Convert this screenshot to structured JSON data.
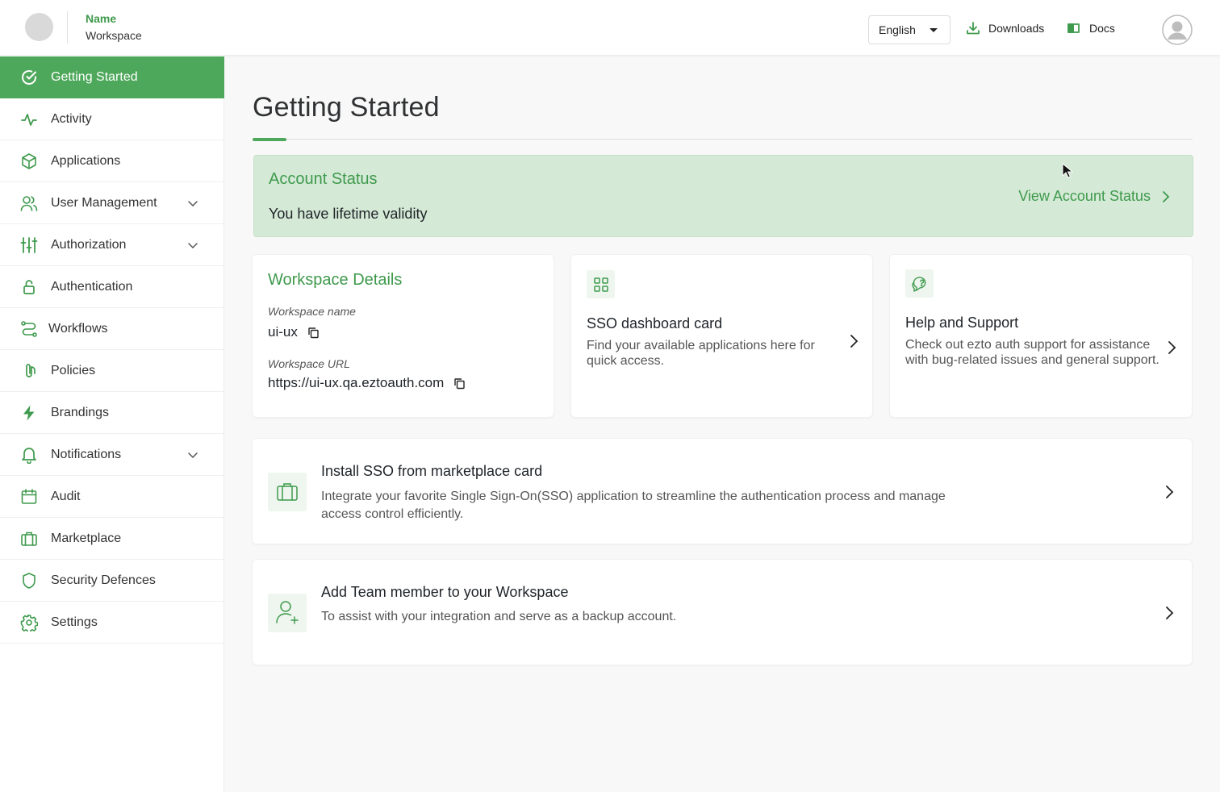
{
  "brand": {
    "name": "Name",
    "workspace": "Workspace"
  },
  "header": {
    "language": "English",
    "downloads": "Downloads",
    "docs": "Docs"
  },
  "sidebar": {
    "items": [
      {
        "label": "Getting Started",
        "icon": "check-circle-icon",
        "active": true
      },
      {
        "label": "Activity",
        "icon": "activity-icon"
      },
      {
        "label": "Applications",
        "icon": "cube-icon"
      },
      {
        "label": "User Management",
        "icon": "users-icon",
        "expandable": true
      },
      {
        "label": "Authorization",
        "icon": "sliders-icon",
        "expandable": true
      },
      {
        "label": "Authentication",
        "icon": "lock-icon"
      },
      {
        "label": "Workflows",
        "icon": "route-icon"
      },
      {
        "label": "Policies",
        "icon": "paperclip-icon"
      },
      {
        "label": "Brandings",
        "icon": "bolt-icon"
      },
      {
        "label": "Notifications",
        "icon": "bell-icon",
        "expandable": true
      },
      {
        "label": "Audit",
        "icon": "calendar-icon"
      },
      {
        "label": "Marketplace",
        "icon": "briefcase-icon"
      },
      {
        "label": "Security Defences",
        "icon": "shield-icon"
      },
      {
        "label": "Settings",
        "icon": "gear-icon"
      }
    ]
  },
  "main": {
    "title": "Getting Started",
    "account_status": {
      "title": "Account Status",
      "text": "You have lifetime validity",
      "link": "View Account Status"
    },
    "workspace_details": {
      "title": "Workspace Details",
      "name_label": "Workspace name",
      "name_value": "ui-ux",
      "url_label": "Workspace URL",
      "url_value": "https://ui-ux.qa.eztoauth.com"
    },
    "sso_card": {
      "title": "SSO dashboard card",
      "desc": "Find your available applications here for quick access."
    },
    "help_card": {
      "title": "Help and Support",
      "desc": "Check out ezto auth support for assistance with bug-related issues and general support."
    },
    "marketplace_card": {
      "title": "Install SSO from marketplace card",
      "desc": "Integrate your favorite Single Sign-On(SSO) application to streamline the authentication process and manage access control efficiently."
    },
    "team_card": {
      "title": "Add Team member to your Workspace",
      "desc": "To assist with your integration and serve as a backup account."
    }
  },
  "colors": {
    "accent": "#4ea85b",
    "accent_text": "#3f9a4d",
    "status_bg": "#d4e9d6"
  }
}
